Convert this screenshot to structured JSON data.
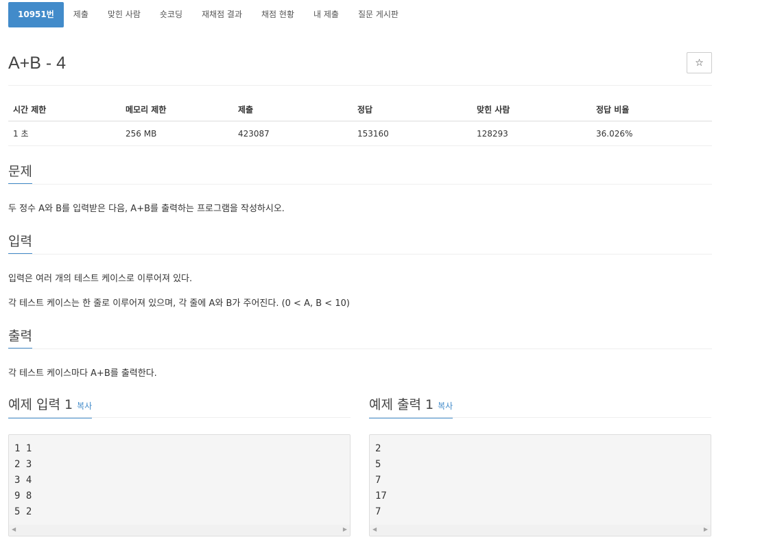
{
  "tabs": [
    {
      "label": "10951번",
      "active": true
    },
    {
      "label": "제출"
    },
    {
      "label": "맞힌 사람"
    },
    {
      "label": "숏코딩"
    },
    {
      "label": "재채점 결과"
    },
    {
      "label": "채점 현황"
    },
    {
      "label": "내 제출"
    },
    {
      "label": "질문 게시판"
    }
  ],
  "problem": {
    "title": "A+B - 4",
    "star_icon": "☆"
  },
  "info": {
    "headers": [
      "시간 제한",
      "메모리 제한",
      "제출",
      "정답",
      "맞힌 사람",
      "정답 비율"
    ],
    "values": [
      "1 초",
      "256 MB",
      "423087",
      "153160",
      "128293",
      "36.026%"
    ]
  },
  "sections": {
    "description": {
      "title": "문제",
      "paragraphs": [
        "두 정수 A와 B를 입력받은 다음, A+B를 출력하는 프로그램을 작성하시오."
      ]
    },
    "input": {
      "title": "입력",
      "paragraphs": [
        "입력은 여러 개의 테스트 케이스로 이루어져 있다.",
        "각 테스트 케이스는 한 줄로 이루어져 있으며, 각 줄에 A와 B가 주어진다. (0 < A, B < 10)"
      ]
    },
    "output": {
      "title": "출력",
      "paragraphs": [
        "각 테스트 케이스마다 A+B를 출력한다."
      ]
    }
  },
  "samples": {
    "input": {
      "title": "예제 입력 1",
      "copy_label": "복사",
      "content": "1 1\n2 3\n3 4\n9 8\n5 2"
    },
    "output": {
      "title": "예제 출력 1",
      "copy_label": "복사",
      "content": "2\n5\n7\n17\n7"
    }
  },
  "scrollbar": {
    "left_arrow": "◀",
    "right_arrow": "▶"
  }
}
